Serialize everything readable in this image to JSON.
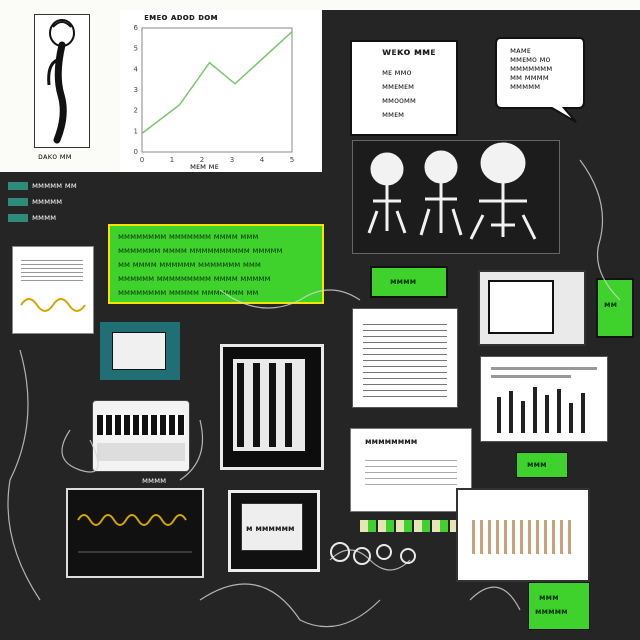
{
  "figure_caption": "ᴅᴀᴋᴏ ᴍᴍ",
  "chart": {
    "title": "ᴇᴍᴇᴏ ᴀᴅᴏᴅ ᴅᴏᴍ",
    "footer": "ᴍᴇᴍ ᴍᴇ",
    "x_ticks": [
      "0",
      "1",
      "2",
      "3",
      "4",
      "5"
    ],
    "y_ticks": [
      "0",
      "1",
      "2",
      "3",
      "4",
      "5",
      "6"
    ]
  },
  "top_right": {
    "card_title": "ᴡᴇᴋᴏ ᴍᴍᴇ",
    "card_lines": [
      "ᴍᴇ ᴍᴍᴏ",
      "ᴍᴍᴇᴍᴇᴍ",
      "ᴍᴍᴏᴏᴍᴍ",
      "ᴍᴍᴇᴍ"
    ],
    "bubble_lines": [
      "ᴍᴀᴍᴇ",
      "ᴍᴍᴇᴍᴏ ᴍᴏ",
      "ᴍᴍᴍᴍᴍᴍᴍ",
      "ᴍᴍ ᴍᴍᴍᴍ",
      "ᴍᴍᴍᴍᴍ"
    ]
  },
  "left_menu": [
    "ᴍᴍᴍᴍᴍ ᴍᴍ",
    "ᴍᴍᴍᴍᴍ",
    "ᴍᴍᴍᴍ"
  ],
  "green_banner": {
    "lines": [
      "ᴍᴍᴍᴍᴍᴍᴍᴍ ᴍᴍᴍᴍᴍᴍᴍ ᴍᴍᴍᴍ ᴍᴍᴍ",
      "ᴍᴍᴍᴍᴍᴍᴍ ᴍᴍᴍᴍ ᴍᴍᴍᴍᴍᴍᴍᴍᴍᴍ ᴍᴍᴍᴍᴍ",
      "ᴍᴍ ᴍᴍᴍᴍ ᴍᴍᴍᴍᴍᴍ ᴍᴍᴍᴍᴍᴍᴍ ᴍᴍᴍ",
      "ᴍᴍᴍᴍᴍᴍ ᴍᴍᴍᴍᴍᴍᴍᴍᴍ ᴍᴍᴍᴍ ᴍᴍᴍᴍᴍ",
      "ᴍᴍᴍᴍᴍᴍᴍᴍ ᴍᴍᴍᴍᴍ ᴍᴍᴍᴍᴍᴍᴍ ᴍᴍ"
    ]
  },
  "center_green_label": "ᴍᴍᴍᴍ",
  "right_green_label": "ᴍᴍ",
  "mid_card_title": "ᴍᴍᴍᴍᴍᴍᴍᴍ",
  "bottom_center_label": "ᴍ ᴍᴍᴍᴍᴍᴍ",
  "bottom_right_green": [
    "ᴍᴍᴍ",
    "ᴍᴍᴍᴍᴍ"
  ],
  "small_green_label": "ᴍᴍᴍ",
  "wave_card_caption": "ᴍᴍᴍᴍ",
  "colors": {
    "background": "#fbfbf8",
    "dark": "#252525",
    "green": "#3fd12c",
    "line": "#78c66b"
  },
  "icons": [
    "robot-figure-icon",
    "skeleton-figure-icon",
    "speech-bubble-icon",
    "wave-chart-icon",
    "bar-chart-icon"
  ]
}
